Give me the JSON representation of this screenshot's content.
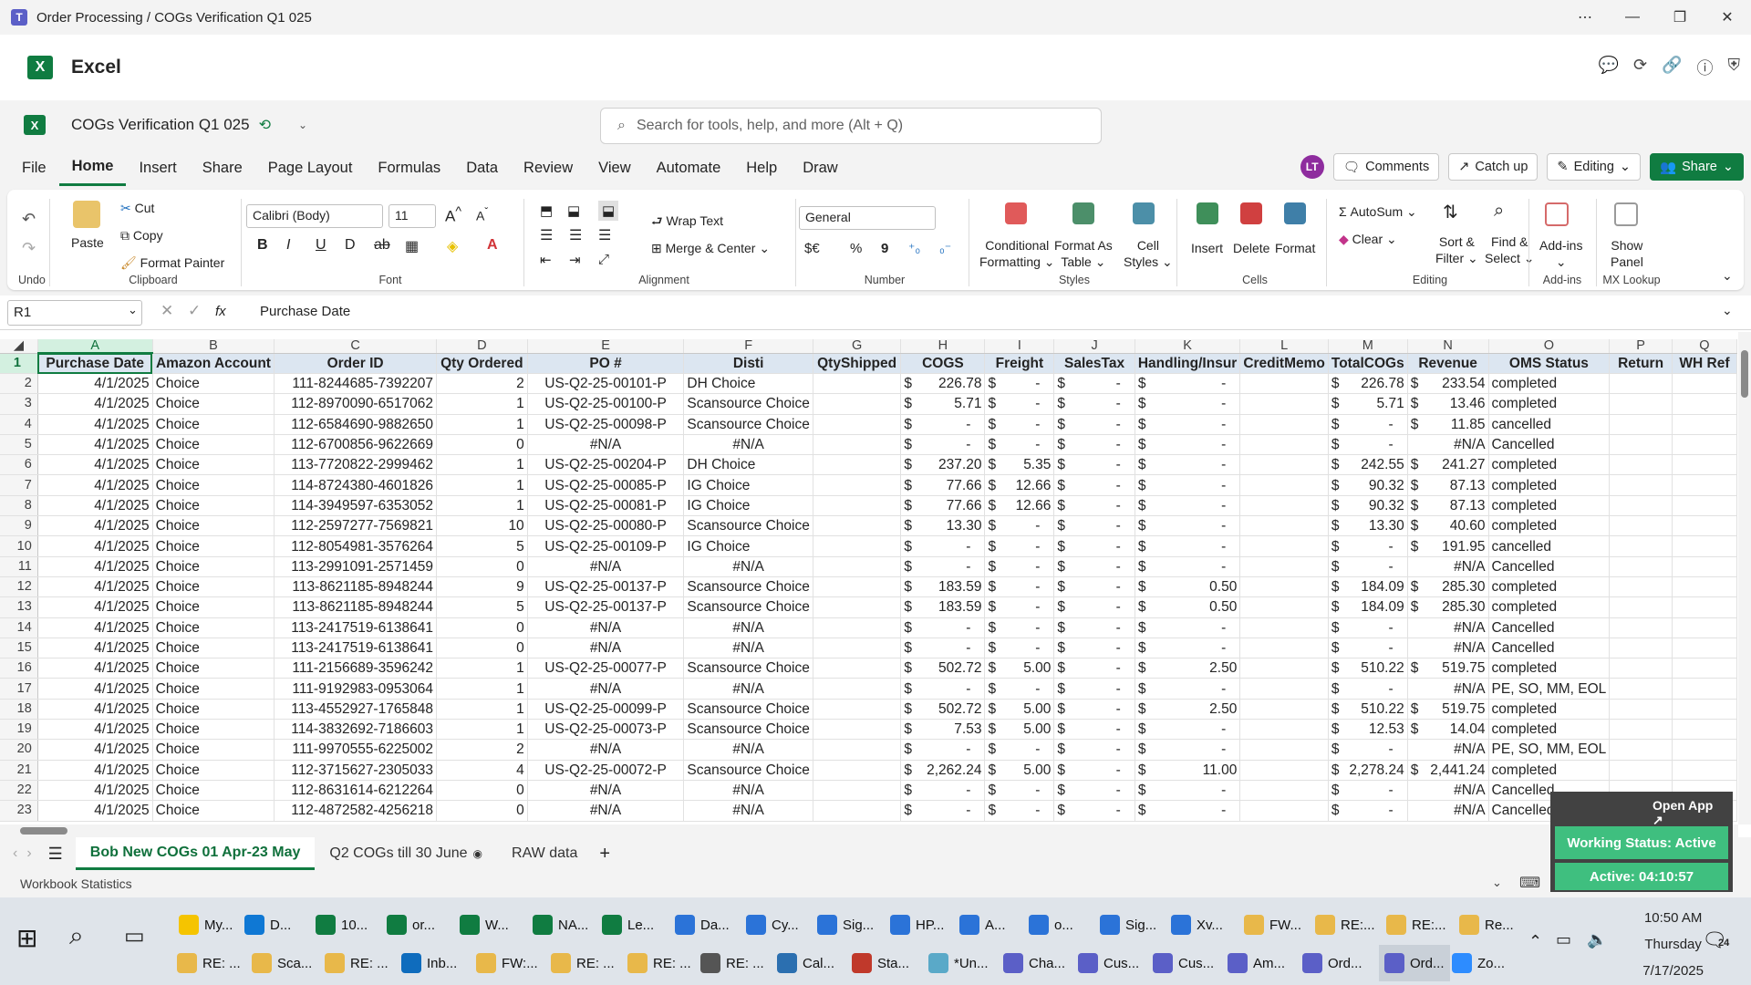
{
  "window": {
    "title": "Order Processing / COGs Verification Q1 025"
  },
  "app": {
    "name": "Excel"
  },
  "doc": {
    "name": "COGs Verification Q1 025",
    "search_placeholder": "Search for tools, help, and more (Alt + Q)"
  },
  "menu": {
    "tabs": [
      "File",
      "Home",
      "Insert",
      "Share",
      "Page Layout",
      "Formulas",
      "Data",
      "Review",
      "View",
      "Automate",
      "Help",
      "Draw"
    ],
    "avatar": "LT",
    "comments": "Comments",
    "catchup": "Catch up",
    "editing": "Editing",
    "share": "Share"
  },
  "ribbon": {
    "cut": "Cut",
    "copy": "Copy",
    "format_painter": "Format Painter",
    "paste": "Paste",
    "font_name": "Calibri (Body)",
    "font_size": "11",
    "wrap": "Wrap Text",
    "merge": "Merge & Center",
    "number_format": "General",
    "cond": "Conditional",
    "cond2": "Formatting",
    "fat": "Format As",
    "fat2": "Table",
    "cells_st": "Cell",
    "cells_st2": "Styles",
    "insert": "Insert",
    "delete": "Delete",
    "format": "Format",
    "autosum": "AutoSum",
    "clear": "Clear",
    "sort": "Sort &",
    "sort2": "Filter",
    "find": "Find &",
    "find2": "Select",
    "addins": "Add-ins",
    "show": "Show",
    "show2": "Panel",
    "groups": {
      "undo": "Undo",
      "clipboard": "Clipboard",
      "font": "Font",
      "alignment": "Alignment",
      "number": "Number",
      "styles": "Styles",
      "cells": "Cells",
      "editing": "Editing",
      "addins": "Add-ins",
      "mxlookup": "MX Lookup"
    },
    "currency": "$€",
    "percent": "%",
    "comma": "9"
  },
  "formula": {
    "cell": "R1",
    "fx": "fx",
    "content": "Purchase Date"
  },
  "columns": [
    "A",
    "B",
    "C",
    "D",
    "E",
    "F",
    "G",
    "H",
    "I",
    "J",
    "K",
    "L",
    "M",
    "N",
    "O",
    "P",
    "Q"
  ],
  "header_row": [
    "Purchase Date",
    "Amazon Account",
    "Order ID",
    "Qty Ordered",
    "PO #",
    "Disti",
    "QtyShipped",
    "COGS",
    "Freight",
    "SalesTax",
    "Handling/Insur",
    "CreditMemo",
    "TotalCOGs",
    "Revenue",
    "OMS Status",
    "Return",
    "WH Ref"
  ],
  "rows": [
    [
      "2",
      "4/1/2025",
      "Choice",
      "111-8244685-7392207",
      "2",
      "US-Q2-25-00101-P",
      "DH Choice",
      "",
      "226.78",
      "-",
      "-",
      "-",
      "",
      "226.78",
      "233.54",
      "completed"
    ],
    [
      "3",
      "4/1/2025",
      "Choice",
      "112-8970090-6517062",
      "1",
      "US-Q2-25-00100-P",
      "Scansource Choice",
      "",
      "5.71",
      "-",
      "-",
      "-",
      "",
      "5.71",
      "13.46",
      "completed"
    ],
    [
      "4",
      "4/1/2025",
      "Choice",
      "112-6584690-9882650",
      "1",
      "US-Q2-25-00098-P",
      "Scansource Choice",
      "",
      "-",
      "-",
      "-",
      "-",
      "",
      "-",
      "11.85",
      "cancelled"
    ],
    [
      "5",
      "4/1/2025",
      "Choice",
      "112-6700856-9622669",
      "0",
      "#N/A",
      "#N/A",
      "",
      "-",
      "-",
      "-",
      "-",
      "",
      "-",
      "#N/A",
      "Cancelled"
    ],
    [
      "6",
      "4/1/2025",
      "Choice",
      "113-7720822-2999462",
      "1",
      "US-Q2-25-00204-P",
      "DH Choice",
      "",
      "237.20",
      "5.35",
      "-",
      "-",
      "",
      "242.55",
      "241.27",
      "completed"
    ],
    [
      "7",
      "4/1/2025",
      "Choice",
      "114-8724380-4601826",
      "1",
      "US-Q2-25-00085-P",
      "IG Choice",
      "",
      "77.66",
      "12.66",
      "-",
      "-",
      "",
      "90.32",
      "87.13",
      "completed"
    ],
    [
      "8",
      "4/1/2025",
      "Choice",
      "114-3949597-6353052",
      "1",
      "US-Q2-25-00081-P",
      "IG Choice",
      "",
      "77.66",
      "12.66",
      "-",
      "-",
      "",
      "90.32",
      "87.13",
      "completed"
    ],
    [
      "9",
      "4/1/2025",
      "Choice",
      "112-2597277-7569821",
      "10",
      "US-Q2-25-00080-P",
      "Scansource Choice",
      "",
      "13.30",
      "-",
      "-",
      "-",
      "",
      "13.30",
      "40.60",
      "completed"
    ],
    [
      "10",
      "4/1/2025",
      "Choice",
      "112-8054981-3576264",
      "5",
      "US-Q2-25-00109-P",
      "IG Choice",
      "",
      "-",
      "-",
      "-",
      "-",
      "",
      "-",
      "191.95",
      "cancelled"
    ],
    [
      "11",
      "4/1/2025",
      "Choice",
      "113-2991091-2571459",
      "0",
      "#N/A",
      "#N/A",
      "",
      "-",
      "-",
      "-",
      "-",
      "",
      "-",
      "#N/A",
      "Cancelled"
    ],
    [
      "12",
      "4/1/2025",
      "Choice",
      "113-8621185-8948244",
      "9",
      "US-Q2-25-00137-P",
      "Scansource Choice",
      "",
      "183.59",
      "-",
      "-",
      "0.50",
      "",
      "184.09",
      "285.30",
      "completed"
    ],
    [
      "13",
      "4/1/2025",
      "Choice",
      "113-8621185-8948244",
      "5",
      "US-Q2-25-00137-P",
      "Scansource Choice",
      "",
      "183.59",
      "-",
      "-",
      "0.50",
      "",
      "184.09",
      "285.30",
      "completed"
    ],
    [
      "14",
      "4/1/2025",
      "Choice",
      "113-2417519-6138641",
      "0",
      "#N/A",
      "#N/A",
      "",
      "-",
      "-",
      "-",
      "-",
      "",
      "-",
      "#N/A",
      "Cancelled"
    ],
    [
      "15",
      "4/1/2025",
      "Choice",
      "113-2417519-6138641",
      "0",
      "#N/A",
      "#N/A",
      "",
      "-",
      "-",
      "-",
      "-",
      "",
      "-",
      "#N/A",
      "Cancelled"
    ],
    [
      "16",
      "4/1/2025",
      "Choice",
      "111-2156689-3596242",
      "1",
      "US-Q2-25-00077-P",
      "Scansource Choice",
      "",
      "502.72",
      "5.00",
      "-",
      "2.50",
      "",
      "510.22",
      "519.75",
      "completed"
    ],
    [
      "17",
      "4/1/2025",
      "Choice",
      "111-9192983-0953064",
      "1",
      "#N/A",
      "#N/A",
      "",
      "-",
      "-",
      "-",
      "-",
      "",
      "-",
      "#N/A",
      "PE, SO, MM, EOL"
    ],
    [
      "18",
      "4/1/2025",
      "Choice",
      "113-4552927-1765848",
      "1",
      "US-Q2-25-00099-P",
      "Scansource Choice",
      "",
      "502.72",
      "5.00",
      "-",
      "2.50",
      "",
      "510.22",
      "519.75",
      "completed"
    ],
    [
      "19",
      "4/1/2025",
      "Choice",
      "114-3832692-7186603",
      "1",
      "US-Q2-25-00073-P",
      "Scansource Choice",
      "",
      "7.53",
      "5.00",
      "-",
      "-",
      "",
      "12.53",
      "14.04",
      "completed"
    ],
    [
      "20",
      "4/1/2025",
      "Choice",
      "111-9970555-6225002",
      "2",
      "#N/A",
      "#N/A",
      "",
      "-",
      "-",
      "-",
      "-",
      "",
      "-",
      "#N/A",
      "PE, SO, MM, EOL"
    ],
    [
      "21",
      "4/1/2025",
      "Choice",
      "112-3715627-2305033",
      "4",
      "US-Q2-25-00072-P",
      "Scansource Choice",
      "",
      "2,262.24",
      "5.00",
      "-",
      "11.00",
      "",
      "2,278.24",
      "2,441.24",
      "completed"
    ],
    [
      "22",
      "4/1/2025",
      "Choice",
      "112-8631614-6212264",
      "0",
      "#N/A",
      "#N/A",
      "",
      "-",
      "-",
      "-",
      "-",
      "",
      "-",
      "#N/A",
      "Cancelled"
    ],
    [
      "23",
      "4/1/2025",
      "Choice",
      "112-4872582-4256218",
      "0",
      "#N/A",
      "#N/A",
      "",
      "-",
      "-",
      "-",
      "-",
      "",
      "-",
      "#N/A",
      "Cancelled"
    ]
  ],
  "sheets": [
    "Bob New COGs 01 Apr-23 May",
    "Q2 COGs till 30 June",
    "RAW data"
  ],
  "status": {
    "left": "Workbook Statistics"
  },
  "overlay": {
    "open_app": "Open App ↗",
    "working": "Working Status: Active",
    "active": "Active: 04:10:57"
  },
  "taskbar": {
    "row1": [
      "My...",
      "D...",
      "10...",
      "or...",
      "W...",
      "NA...",
      "Le...",
      "Da...",
      "Cy...",
      "Sig...",
      "HP...",
      "A...",
      "o...",
      "Sig...",
      "Xv...",
      "FW...",
      "RE:...",
      "RE:...",
      "Re..."
    ],
    "row2": [
      "RE: ...",
      "Sca...",
      "RE: ...",
      "Inb...",
      "FW:...",
      "RE: ...",
      "RE: ...",
      "RE: ...",
      "Cal...",
      "Sta...",
      "*Un...",
      "Cha...",
      "Cus...",
      "Cus...",
      "Am...",
      "Ord...",
      "Ord...",
      "Zo..."
    ],
    "time": "10:50 AM",
    "day": "Thursday",
    "date": "7/17/2025",
    "notif": "24"
  },
  "colors": {
    "excel_green": "#107c41",
    "header_fill": "#dce6f1"
  }
}
